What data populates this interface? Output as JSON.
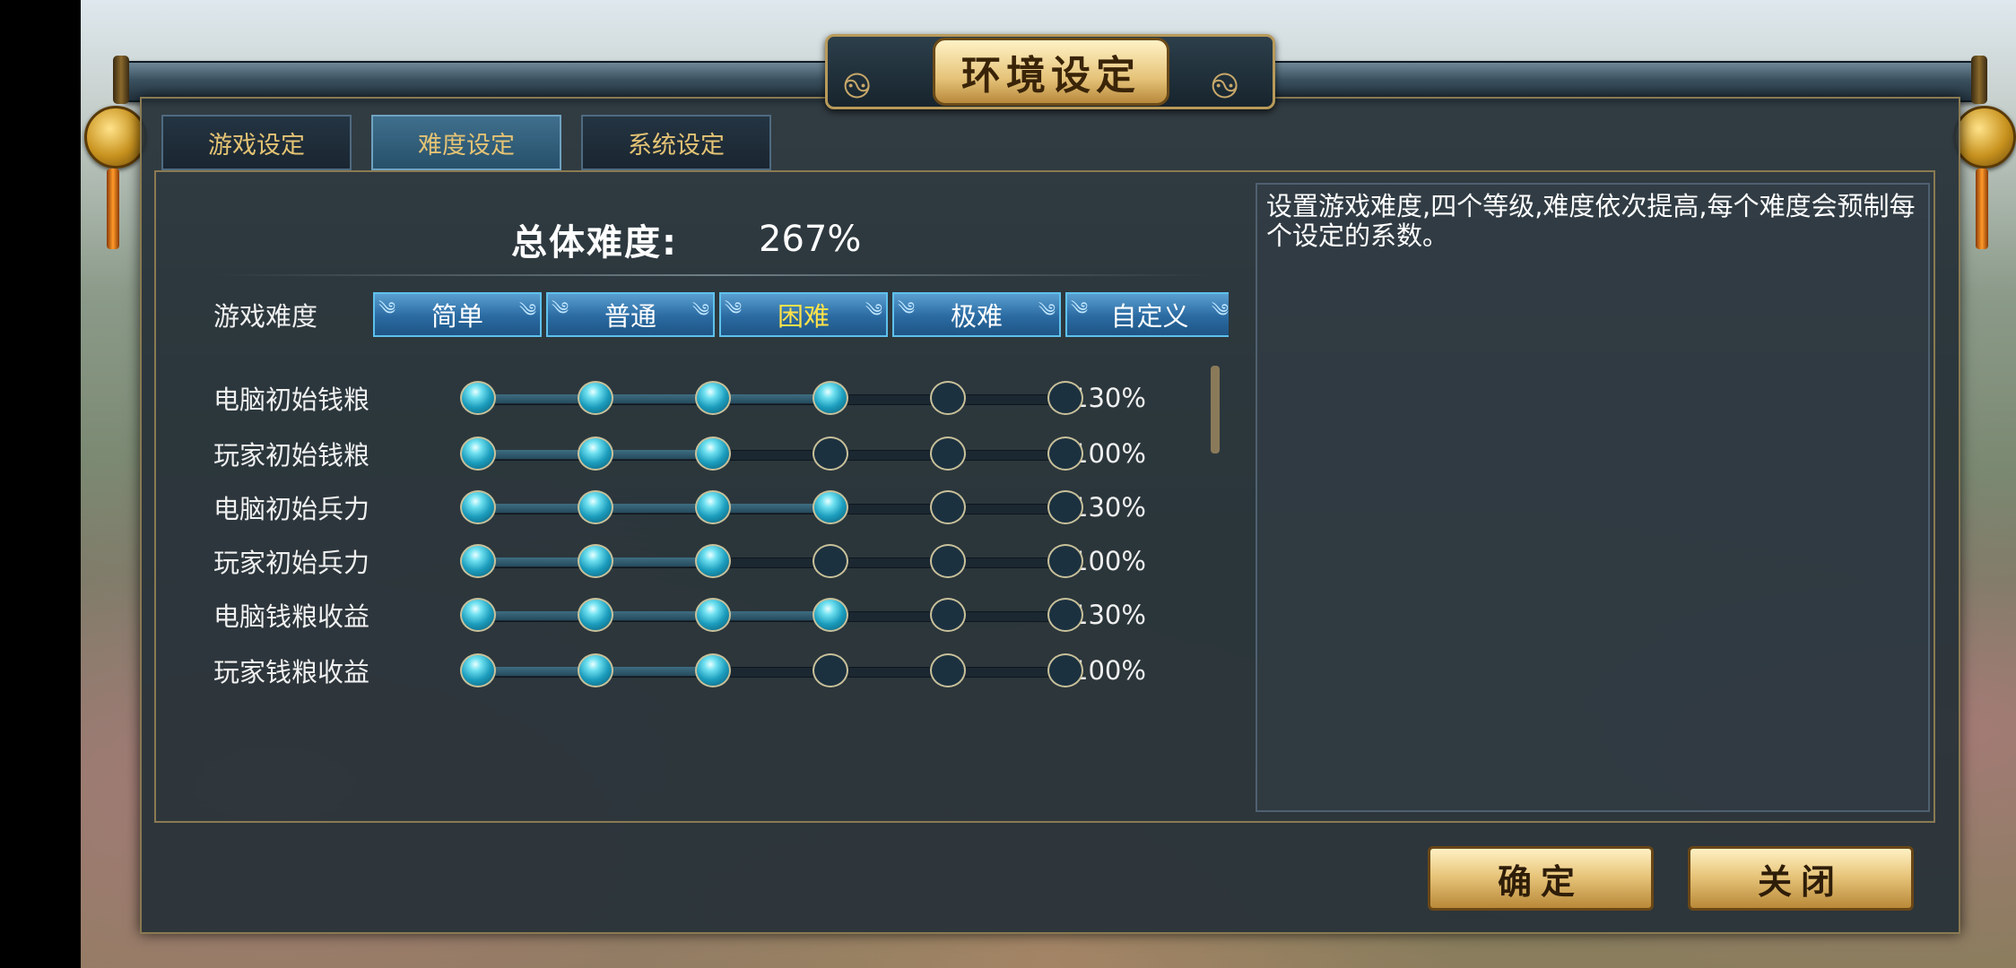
{
  "window": {
    "title": "环境设定"
  },
  "tabs": [
    {
      "label": "游戏设定",
      "active": false
    },
    {
      "label": "难度设定",
      "active": true
    },
    {
      "label": "系统设定",
      "active": false
    }
  ],
  "overall": {
    "label": "总体难度:",
    "value": "267%"
  },
  "difficulty": {
    "label": "游戏难度",
    "options": [
      "简单",
      "普通",
      "困难",
      "极难",
      "自定义"
    ],
    "selected": "困难"
  },
  "sliders": [
    {
      "label": "电脑初始钱粮",
      "level": 4,
      "steps": 6,
      "value": "130%"
    },
    {
      "label": "玩家初始钱粮",
      "level": 3,
      "steps": 6,
      "value": "100%"
    },
    {
      "label": "电脑初始兵力",
      "level": 4,
      "steps": 6,
      "value": "130%"
    },
    {
      "label": "玩家初始兵力",
      "level": 3,
      "steps": 6,
      "value": "100%"
    },
    {
      "label": "电脑钱粮收益",
      "level": 4,
      "steps": 6,
      "value": "130%"
    },
    {
      "label": "玩家钱粮收益",
      "level": 3,
      "steps": 6,
      "value": "100%"
    }
  ],
  "description": "设置游戏难度,四个等级,难度依次提高,每个难度会预制每个设定的系数。",
  "buttons": {
    "confirm": "确定",
    "close": "关闭"
  },
  "colors": {
    "gold_text": "#e4c374",
    "selected_text": "#ffe24a",
    "panel_bg": "#263038",
    "accent_blue": "#2a6aa2"
  }
}
